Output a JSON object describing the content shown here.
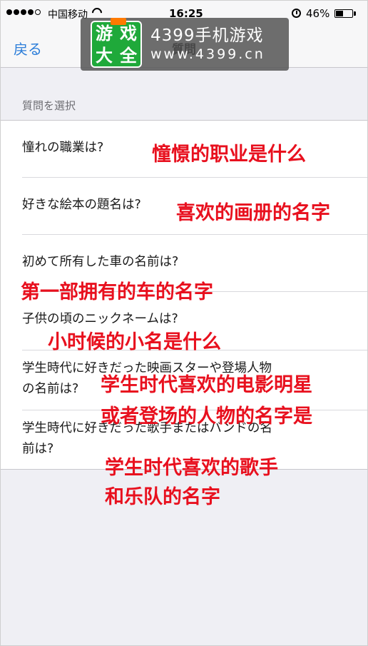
{
  "status_bar": {
    "carrier": "中国移动",
    "time": "16:25",
    "battery_percent_label": "46%",
    "battery_level": 0.46
  },
  "nav": {
    "back_label": "戻る",
    "title": "質問"
  },
  "watermark": {
    "logo_chars": [
      "游",
      "戏",
      "大",
      "全"
    ],
    "name": "4399手机游戏",
    "url": "www.4399.cn"
  },
  "section": {
    "header": "質問を選択"
  },
  "questions": [
    {
      "text": "憧れの職業は?"
    },
    {
      "text": "好きな絵本の題名は?"
    },
    {
      "text": "初めて所有した車の名前は?"
    },
    {
      "text": "子供の頃のニックネームは?"
    },
    {
      "text": "学生時代に好きだった映画スターや登場人物の名前は?",
      "lines": [
        "学生時代に好きだった映画スターや登場人物",
        "の名前は?"
      ]
    },
    {
      "text": "学生時代に好きだった歌手またはバンドの名前は?",
      "lines": [
        "学生時代に好きだった歌手またはバンドの名",
        "前は?"
      ]
    }
  ],
  "annotations": {
    "a1": "憧憬的职业是什么",
    "a2": "喜欢的画册的名字",
    "a3": "第一部拥有的车的名字",
    "a4": "小时候的小名是什么",
    "a5_line1": "学生时代喜欢的电影明星",
    "a5_line2": "或者登场的人物的名字是",
    "a6_line1": "学生时代喜欢的歌手",
    "a6_line2": "和乐队的名字"
  },
  "colors": {
    "accent": "#2d7ed9",
    "annotation": "#e8101e",
    "background": "#efeff4"
  }
}
